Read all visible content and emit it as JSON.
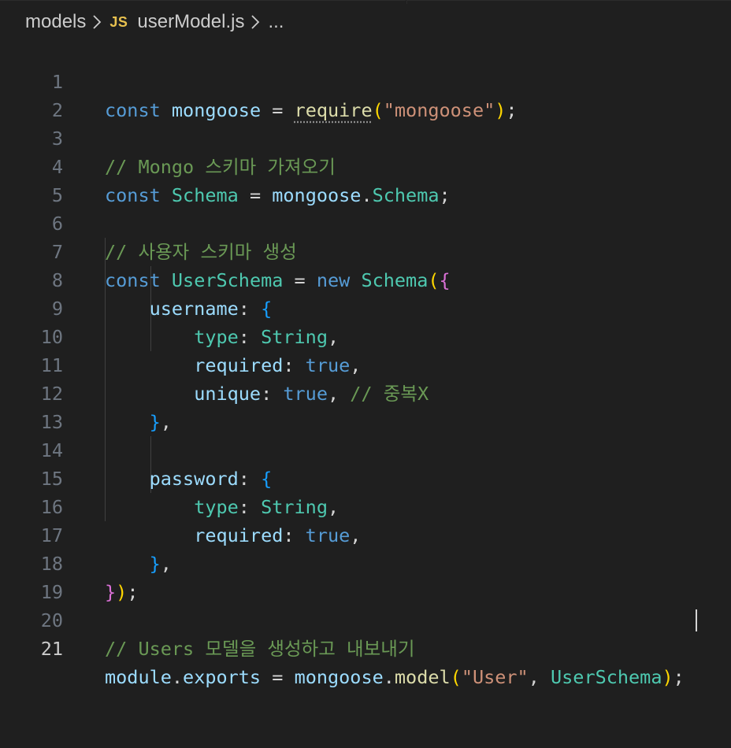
{
  "breadcrumb": {
    "folder": "models",
    "file_icon": "JS",
    "file": "userModel.js",
    "symbol": "..."
  },
  "editor": {
    "active_line": 21,
    "line_numbers": [
      "1",
      "2",
      "3",
      "4",
      "5",
      "6",
      "7",
      "8",
      "9",
      "10",
      "11",
      "12",
      "13",
      "14",
      "15",
      "16",
      "17",
      "18",
      "19",
      "20",
      "21"
    ],
    "comments": {
      "line3": "// Mongo 스키마 가져오기",
      "line6": "// 사용자 스키마 생성",
      "line11": "// 중복X",
      "line20": "// Users 모델을 생성하고 내보내기"
    },
    "strings": {
      "mongoose": "\"mongoose\"",
      "user": "\"User\""
    }
  },
  "colors": {
    "background": "#1f1f1f",
    "keyword": "#569cd6",
    "variable": "#9cdcfe",
    "function": "#dcdcaa",
    "string": "#ce9178",
    "comment": "#6a9955",
    "class": "#4ec9b0"
  }
}
